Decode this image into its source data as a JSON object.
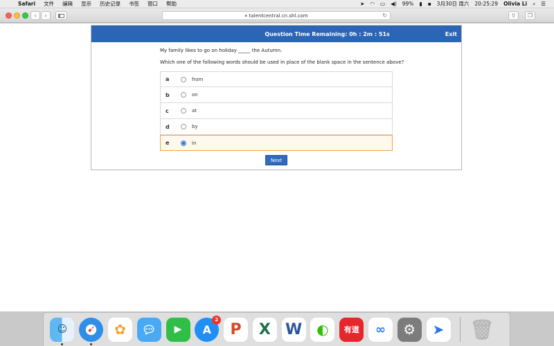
{
  "menubar": {
    "app": "Safari",
    "items": [
      "文件",
      "编辑",
      "显示",
      "历史记录",
      "书签",
      "窗口",
      "帮助"
    ],
    "battery": "99%",
    "date": "3月30日 周六",
    "time": "20:25:29",
    "user": "Olivia Li"
  },
  "toolbar": {
    "url": "talentcentral.cn.shl.com",
    "back_icon": "‹",
    "forward_icon": "›"
  },
  "quiz": {
    "timer": "Question Time Remaining: 0h : 2m : 51s",
    "exit": "Exit",
    "question": "My family likes to go on holiday _____ the Autumn.",
    "prompt": "Which one of the following words should be used in place of the blank space in the sentence above?",
    "options": [
      {
        "letter": "a",
        "text": "from"
      },
      {
        "letter": "b",
        "text": "on"
      },
      {
        "letter": "c",
        "text": "at"
      },
      {
        "letter": "d",
        "text": "by"
      },
      {
        "letter": "e",
        "text": "in"
      }
    ],
    "selected": "e",
    "next": "Next"
  },
  "dock": {
    "app_store_badge": "2",
    "youdao_label": "有道",
    "apps": [
      "finder",
      "safari",
      "photos",
      "messages",
      "facetime",
      "app-store",
      "powerpoint",
      "excel",
      "word",
      "wechat",
      "youdao",
      "baidu-netdisk",
      "system-preferences",
      "feishu",
      "trash"
    ]
  },
  "colors": {
    "header_blue": "#2a66b5",
    "selected_border": "#f0a44b",
    "next_button": "#2f6bbf"
  }
}
